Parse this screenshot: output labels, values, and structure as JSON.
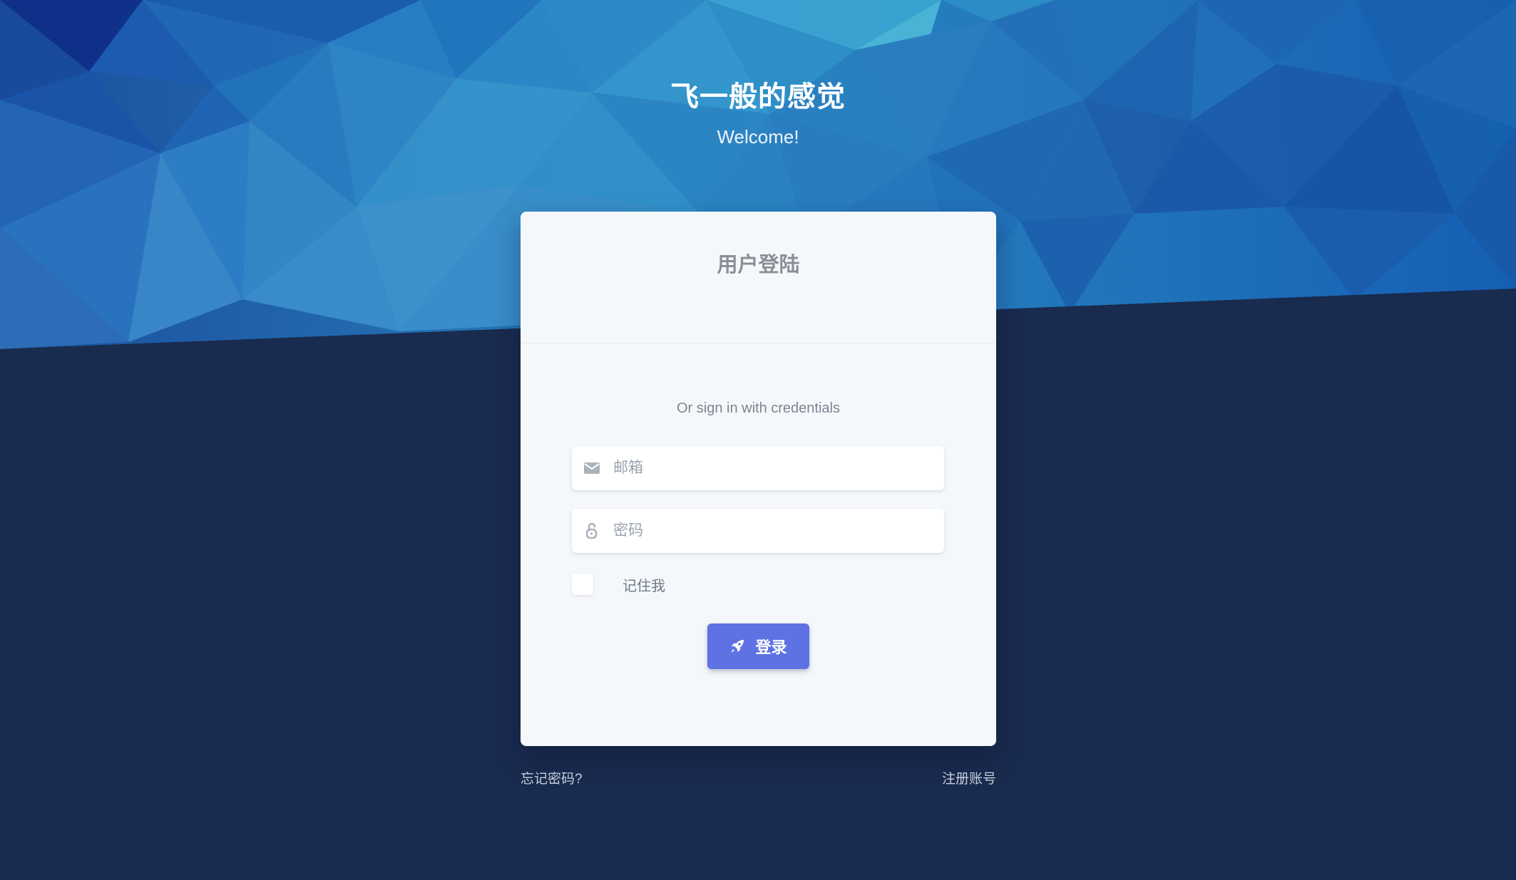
{
  "hero": {
    "title": "飞一般的感觉",
    "subtitle": "Welcome!"
  },
  "login_card": {
    "title": "用户登陆",
    "signin_hint": "Or sign in with credentials",
    "email": {
      "placeholder": "邮箱",
      "value": "",
      "icon": "envelope-icon"
    },
    "password": {
      "placeholder": "密码",
      "value": "",
      "icon": "unlock-icon"
    },
    "remember_me": {
      "label": "记住我",
      "checked": false
    },
    "login_button": {
      "label": "登录",
      "icon": "rocket-icon"
    }
  },
  "footer": {
    "forgot_password": "忘记密码?",
    "register": "注册账号"
  },
  "colors": {
    "dark_background": "#192b4e",
    "card_background": "#f5f8fb",
    "primary_button": "#5e72e4",
    "hero_blue": "#1e5ba8"
  }
}
